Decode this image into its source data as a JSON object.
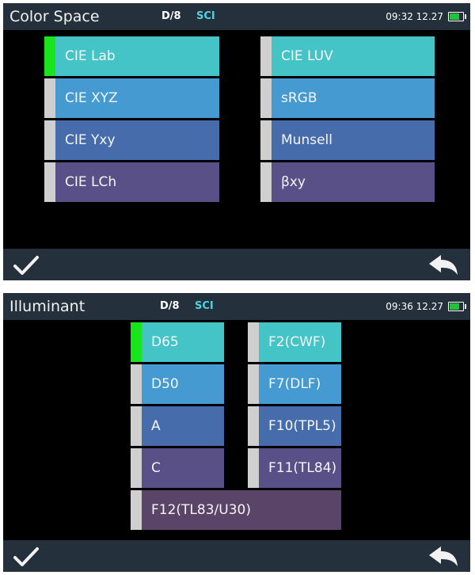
{
  "colors": {
    "row1": "#44c4c6",
    "row2": "#459bd1",
    "row3": "#466cab",
    "row4": "#5a5088",
    "row5": "#5a4568",
    "selected_indicator": "#19e51c",
    "unselected_indicator": "#cfcfcf"
  },
  "color_space_screen": {
    "title": "Color Space",
    "geometry": "D/8",
    "mode": "SCI",
    "clock": "09:32 12.27",
    "options_left": [
      "CIE Lab",
      "CIE XYZ",
      "CIE Yxy",
      "CIE LCh"
    ],
    "options_right": [
      "CIE LUV",
      "sRGB",
      "Munsell",
      "βxy"
    ],
    "selected": "CIE Lab",
    "confirm_icon": "check-icon",
    "back_icon": "back-arrow-icon"
  },
  "illuminant_screen": {
    "title": "Illuminant",
    "geometry": "D/8",
    "mode": "SCI",
    "clock": "09:36 12.27",
    "options_left": [
      "D65",
      "D50",
      "A",
      "C"
    ],
    "options_right": [
      "F2(CWF)",
      "F7(DLF)",
      "F10(TPL5)",
      "F11(TL84)"
    ],
    "option_wide": "F12(TL83/U30)",
    "selected": "D65",
    "confirm_icon": "check-icon",
    "back_icon": "back-arrow-icon"
  }
}
